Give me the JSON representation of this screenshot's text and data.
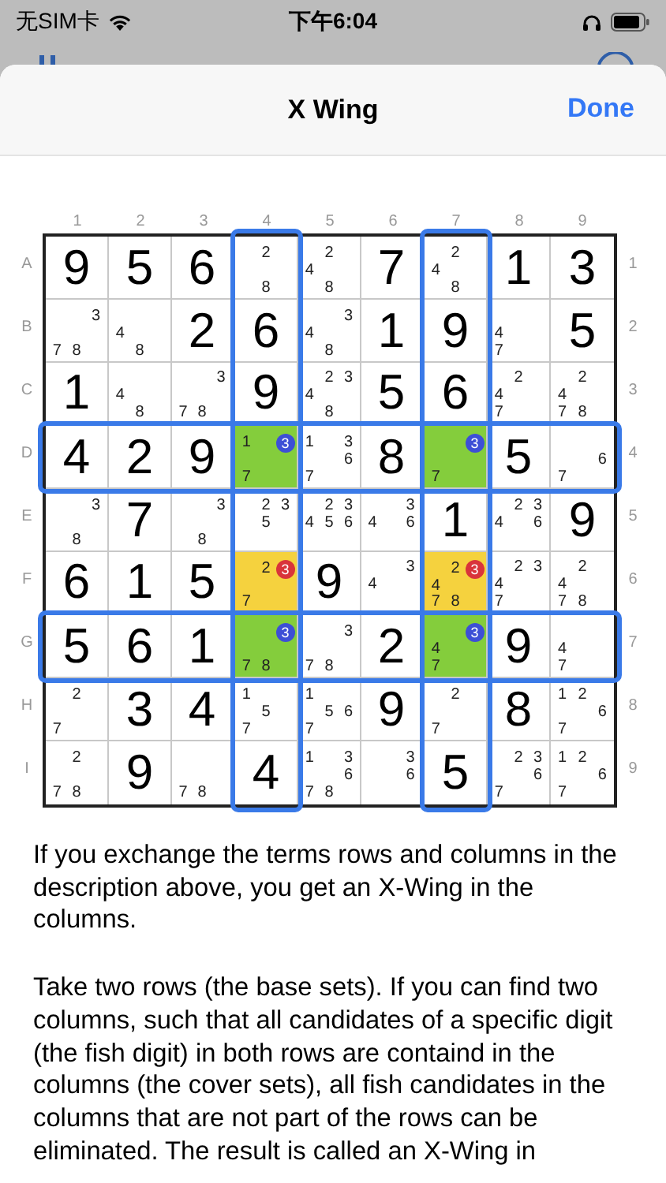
{
  "status_bar": {
    "carrier": "无SIM卡",
    "time": "下午6:04"
  },
  "sheet": {
    "title": "X Wing",
    "done": "Done"
  },
  "columns": [
    {
      "label": "1",
      "outlined": false
    },
    {
      "label": "2",
      "outlined": false
    },
    {
      "label": "3",
      "outlined": false
    },
    {
      "label": "4",
      "outlined": true
    },
    {
      "label": "5",
      "outlined": false
    },
    {
      "label": "6",
      "outlined": false
    },
    {
      "label": "7",
      "outlined": true
    },
    {
      "label": "8",
      "outlined": false
    },
    {
      "label": "9",
      "outlined": false
    }
  ],
  "rows": [
    {
      "label": "A",
      "right_label": "1",
      "outlined": false,
      "cells": [
        {
          "value": "9"
        },
        {
          "value": "5"
        },
        {
          "value": "6"
        },
        {
          "candidates": [
            "2",
            "8"
          ]
        },
        {
          "candidates": [
            "2",
            "4",
            "8"
          ]
        },
        {
          "value": "7"
        },
        {
          "candidates": [
            "2",
            "4",
            "8"
          ]
        },
        {
          "value": "1"
        },
        {
          "value": "3"
        }
      ]
    },
    {
      "label": "B",
      "right_label": "2",
      "outlined": false,
      "cells": [
        {
          "candidates": [
            "3",
            "7",
            "8"
          ]
        },
        {
          "candidates": [
            "4",
            "8"
          ]
        },
        {
          "value": "2"
        },
        {
          "value": "6"
        },
        {
          "candidates": [
            "3",
            "4",
            "8"
          ]
        },
        {
          "value": "1"
        },
        {
          "value": "9"
        },
        {
          "candidates": [
            "4",
            "7"
          ]
        },
        {
          "value": "5"
        }
      ]
    },
    {
      "label": "C",
      "right_label": "3",
      "outlined": false,
      "cells": [
        {
          "value": "1"
        },
        {
          "candidates": [
            "4",
            "8"
          ]
        },
        {
          "candidates": [
            "3",
            "7",
            "8"
          ]
        },
        {
          "value": "9"
        },
        {
          "candidates": [
            "2",
            "3",
            "4",
            "8"
          ]
        },
        {
          "value": "5"
        },
        {
          "value": "6"
        },
        {
          "candidates": [
            "2",
            "4",
            "7"
          ]
        },
        {
          "candidates": [
            "2",
            "4",
            "7",
            "8"
          ]
        }
      ]
    },
    {
      "label": "D",
      "right_label": "4",
      "outlined": true,
      "cells": [
        {
          "value": "4"
        },
        {
          "value": "2"
        },
        {
          "value": "9"
        },
        {
          "candidates": [
            "1",
            "7"
          ],
          "color": "#84cd3c",
          "marked": {
            "digit": "3",
            "color": "#3d4fd6"
          }
        },
        {
          "candidates": [
            "1",
            "3",
            "6",
            "7"
          ]
        },
        {
          "value": "8"
        },
        {
          "candidates": [
            "7"
          ],
          "color": "#84cd3c",
          "marked": {
            "digit": "3",
            "color": "#3d4fd6"
          }
        },
        {
          "value": "5"
        },
        {
          "candidates": [
            "6",
            "7"
          ]
        }
      ]
    },
    {
      "label": "E",
      "right_label": "5",
      "outlined": false,
      "cells": [
        {
          "candidates": [
            "3",
            "8"
          ]
        },
        {
          "value": "7"
        },
        {
          "candidates": [
            "3",
            "8"
          ]
        },
        {
          "candidates": [
            "2",
            "3",
            "5"
          ]
        },
        {
          "candidates": [
            "2",
            "3",
            "4",
            "5",
            "6"
          ]
        },
        {
          "candidates": [
            "3",
            "4",
            "6"
          ]
        },
        {
          "value": "1"
        },
        {
          "candidates": [
            "2",
            "3",
            "4",
            "6"
          ]
        },
        {
          "value": "9"
        }
      ]
    },
    {
      "label": "F",
      "right_label": "6",
      "outlined": false,
      "cells": [
        {
          "value": "6"
        },
        {
          "value": "1"
        },
        {
          "value": "5"
        },
        {
          "candidates": [
            "2",
            "7"
          ],
          "color": "#f5d23e",
          "marked": {
            "digit": "3",
            "color": "#d9343a"
          }
        },
        {
          "value": "9"
        },
        {
          "candidates": [
            "3",
            "4"
          ]
        },
        {
          "candidates": [
            "2",
            "4",
            "7",
            "8"
          ],
          "color": "#f5d23e",
          "marked": {
            "digit": "3",
            "color": "#d9343a"
          }
        },
        {
          "candidates": [
            "2",
            "3",
            "4",
            "7"
          ]
        },
        {
          "candidates": [
            "2",
            "4",
            "7",
            "8"
          ]
        }
      ]
    },
    {
      "label": "G",
      "right_label": "7",
      "outlined": true,
      "cells": [
        {
          "value": "5"
        },
        {
          "value": "6"
        },
        {
          "value": "1"
        },
        {
          "candidates": [
            "7",
            "8"
          ],
          "color": "#84cd3c",
          "marked": {
            "digit": "3",
            "color": "#3d4fd6"
          }
        },
        {
          "candidates": [
            "3",
            "7",
            "8"
          ]
        },
        {
          "value": "2"
        },
        {
          "candidates": [
            "4",
            "7"
          ],
          "color": "#84cd3c",
          "marked": {
            "digit": "3",
            "color": "#3d4fd6"
          }
        },
        {
          "value": "9"
        },
        {
          "candidates": [
            "4",
            "7"
          ]
        }
      ]
    },
    {
      "label": "H",
      "right_label": "8",
      "outlined": false,
      "cells": [
        {
          "candidates": [
            "2",
            "7"
          ]
        },
        {
          "value": "3"
        },
        {
          "value": "4"
        },
        {
          "candidates": [
            "1",
            "5",
            "7"
          ]
        },
        {
          "candidates": [
            "1",
            "5",
            "6",
            "7"
          ]
        },
        {
          "value": "9"
        },
        {
          "candidates": [
            "2",
            "7"
          ]
        },
        {
          "value": "8"
        },
        {
          "candidates": [
            "1",
            "2",
            "6",
            "7"
          ]
        }
      ]
    },
    {
      "label": "I",
      "right_label": "9",
      "outlined": false,
      "cells": [
        {
          "candidates": [
            "2",
            "7",
            "8"
          ]
        },
        {
          "value": "9"
        },
        {
          "candidates": [
            "7",
            "8"
          ]
        },
        {
          "value": "4"
        },
        {
          "candidates": [
            "1",
            "3",
            "6",
            "7",
            "8"
          ]
        },
        {
          "candidates": [
            "3",
            "6"
          ]
        },
        {
          "value": "5"
        },
        {
          "candidates": [
            "2",
            "3",
            "6",
            "7"
          ]
        },
        {
          "candidates": [
            "1",
            "2",
            "6",
            "7"
          ]
        }
      ]
    }
  ],
  "paragraphs": [
    "If you exchange the terms rows and columns in the description above, you get an X-Wing in the columns.",
    "Take two rows (the base sets). If you can find two columns, such that all candidates of a specific digit (the fish digit) in both rows are containd in the columns (the cover sets), all fish candidates in the columns that are not part of the rows can be eliminated. The result is called an X-Wing in"
  ]
}
